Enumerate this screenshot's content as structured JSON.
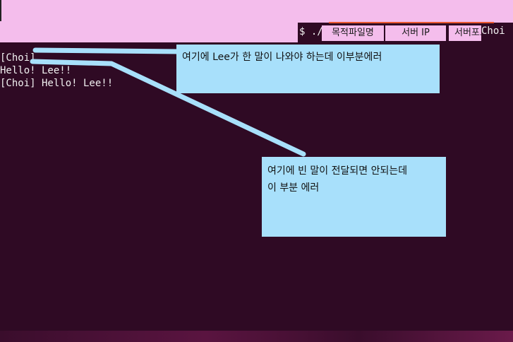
{
  "command_bar": {
    "prefix": "$ ./",
    "arg_file": "목적파일명",
    "arg_ip": "서버 IP",
    "arg_port": "서버포트",
    "user": "Choi"
  },
  "terminal": {
    "lines": [
      "[Choi]",
      "Hello! Lee!!",
      "[Choi] Hello! Lee!!"
    ]
  },
  "annotations": {
    "note1": "여기에 Lee가 한 말이 나와야 하는데 이부분에러",
    "note2_line1": "여기에 빈 말이 전달되면 안되는데",
    "note2_line2": "이 부분 에러"
  },
  "colors": {
    "terminal_bg": "#2f0a24",
    "top_band": "#f4bdec",
    "annotation_bg": "#a8e0fb",
    "arrow": "#a8e0fb"
  }
}
